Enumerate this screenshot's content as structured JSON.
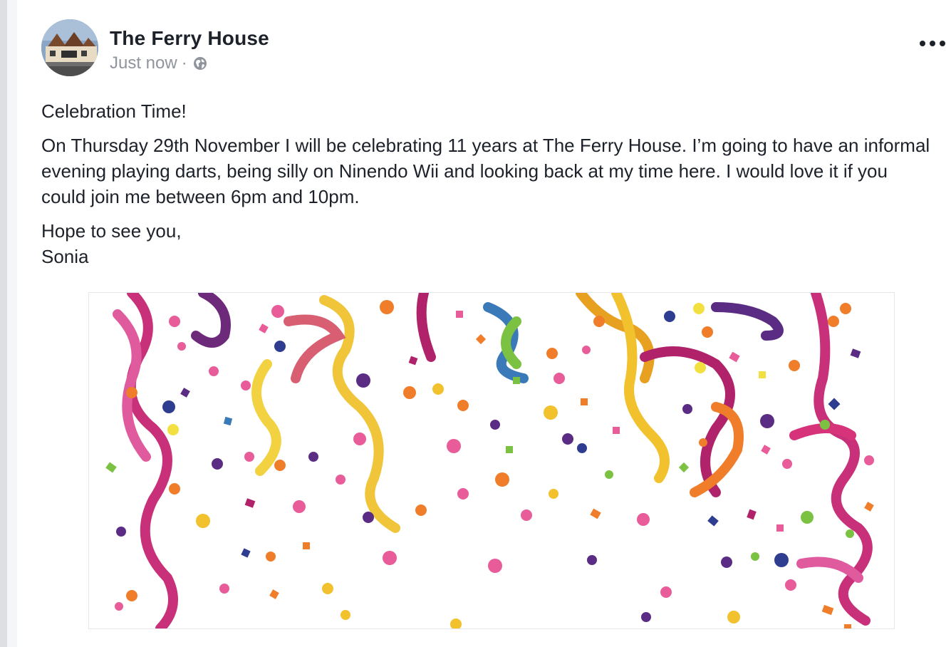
{
  "post": {
    "author": "The Ferry House",
    "timestamp": "Just now",
    "separator": "·",
    "privacy_icon": "globe-icon",
    "menu_icon": "more-options-icon",
    "avatar_icon": "page-avatar-house-photo",
    "paragraphs": [
      "Celebration Time!",
      "On Thursday 29th November I will be celebrating 11 years at The Ferry House. I’m going to have an informal evening playing darts, being silly on Ninendo Wii and looking back at my time here. I would love it if you could join me between 6pm and 10pm."
    ],
    "closing_line_1": "Hope to see you,",
    "closing_line_2": "Sonia",
    "attached_image": "confetti-streamers-image"
  },
  "colors": {
    "author_text": "#1d2129",
    "meta_text": "#90949c",
    "confetti": [
      "#d6337a",
      "#f2c12e",
      "#ef7d2a",
      "#5b2c83",
      "#2e3d8f",
      "#7cc242",
      "#b0236b",
      "#e85c9a"
    ]
  }
}
